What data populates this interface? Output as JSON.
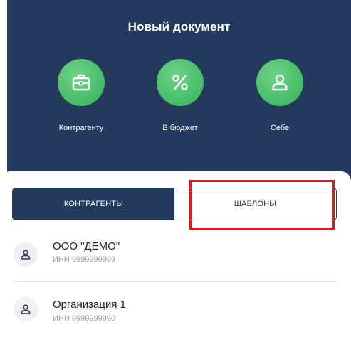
{
  "header": {
    "title": "Новый документ",
    "actions": [
      {
        "label": "Контрагенту",
        "icon": "briefcase-icon"
      },
      {
        "label": "В бюджет",
        "icon": "percent-icon"
      },
      {
        "label": "Себе",
        "icon": "person-icon"
      }
    ]
  },
  "tabs": [
    {
      "label": "КОНТРАГЕНТЫ",
      "active": true
    },
    {
      "label": "ШАБЛОНЫ",
      "active": false
    }
  ],
  "list": {
    "items": [
      {
        "name": "ООО \"ДЕМО\"",
        "inn": "ИНН 9999999999",
        "icon": "person-icon"
      },
      {
        "name": "Организация 1",
        "inn": "ИНН 9999999990",
        "icon": "person-icon"
      }
    ]
  },
  "colors": {
    "header_bg": "#233a5c",
    "accent_green": "#49bf6a",
    "highlight_red": "#e8141a"
  }
}
